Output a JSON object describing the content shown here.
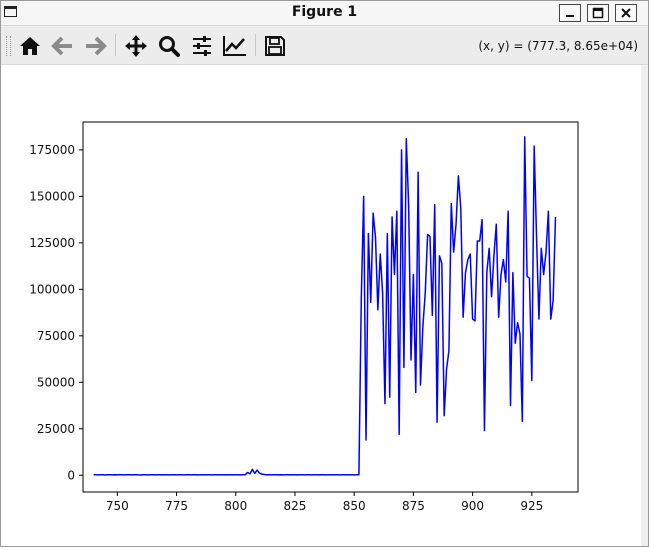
{
  "window": {
    "title": "Figure 1",
    "buttons": [
      "minimize",
      "maximize",
      "close"
    ]
  },
  "toolbar": {
    "items": [
      {
        "name": "home-button",
        "icon": "home-icon"
      },
      {
        "name": "back-button",
        "icon": "arrow-left-icon"
      },
      {
        "name": "forward-button",
        "icon": "arrow-right-icon"
      },
      {
        "name": "pan-button",
        "icon": "move-icon"
      },
      {
        "name": "zoom-button",
        "icon": "zoom-icon"
      },
      {
        "name": "configure-subplots-button",
        "icon": "sliders-icon"
      },
      {
        "name": "edit-axes-button",
        "icon": "chart-line-icon"
      },
      {
        "name": "save-button",
        "icon": "floppy-icon"
      }
    ],
    "coords": "(x, y) = (777.3, 8.65e+04)"
  },
  "chart_data": {
    "type": "line",
    "color": "#0000ff",
    "title": "",
    "xlabel": "",
    "ylabel": "",
    "xlim": [
      735.5,
      944.5
    ],
    "ylim": [
      -9000,
      190000
    ],
    "xticks": [
      750,
      775,
      800,
      825,
      850,
      875,
      900,
      925
    ],
    "yticks": [
      0,
      25000,
      50000,
      75000,
      100000,
      125000,
      150000,
      175000
    ],
    "grid": false,
    "x_start": 740,
    "x_step": 1,
    "series": [
      {
        "values": [
          300,
          250,
          200,
          300,
          250,
          150,
          300,
          250,
          200,
          300,
          200,
          250,
          300,
          200,
          250,
          300,
          200,
          250,
          300,
          200,
          150,
          250,
          300,
          200,
          250,
          300,
          200,
          250,
          300,
          200,
          250,
          300,
          200,
          250,
          300,
          200,
          250,
          300,
          200,
          250,
          300,
          200,
          250,
          300,
          200,
          250,
          300,
          200,
          250,
          300,
          200,
          250,
          300,
          200,
          250,
          300,
          200,
          250,
          300,
          200,
          250,
          300,
          200,
          250,
          300,
          1500,
          800,
          3200,
          1000,
          2800,
          1200,
          600,
          400,
          300,
          250,
          200,
          300,
          250,
          200,
          300,
          200,
          250,
          300,
          200,
          250,
          300,
          200,
          250,
          300,
          200,
          250,
          300,
          200,
          250,
          300,
          200,
          250,
          300,
          200,
          250,
          300,
          200,
          250,
          300,
          200,
          250,
          300,
          200,
          250,
          300,
          200,
          250,
          300,
          95000,
          150000,
          19000,
          130000,
          93000,
          141000,
          128000,
          89000,
          119000,
          98000,
          38500,
          130000,
          42000,
          139000,
          108000,
          142000,
          22000,
          175000,
          58000,
          181000,
          145000,
          62000,
          108000,
          44500,
          163000,
          48500,
          80000,
          98000,
          129500,
          128500,
          86000,
          145500,
          28500,
          118000,
          114000,
          32000,
          57000,
          67000,
          146000,
          120000,
          135000,
          161000,
          144000,
          85000,
          109000,
          116000,
          119000,
          84000,
          83000,
          126000,
          126000,
          137500,
          24000,
          109000,
          122000,
          96000,
          118000,
          135000,
          85000,
          108000,
          116000,
          104000,
          142000,
          37500,
          109000,
          71000,
          82000,
          76000,
          29000,
          182000,
          107000,
          106000,
          51000,
          177000,
          128000,
          84000,
          122000,
          108000,
          120000,
          142000,
          84000,
          94000,
          139000
        ]
      }
    ]
  }
}
